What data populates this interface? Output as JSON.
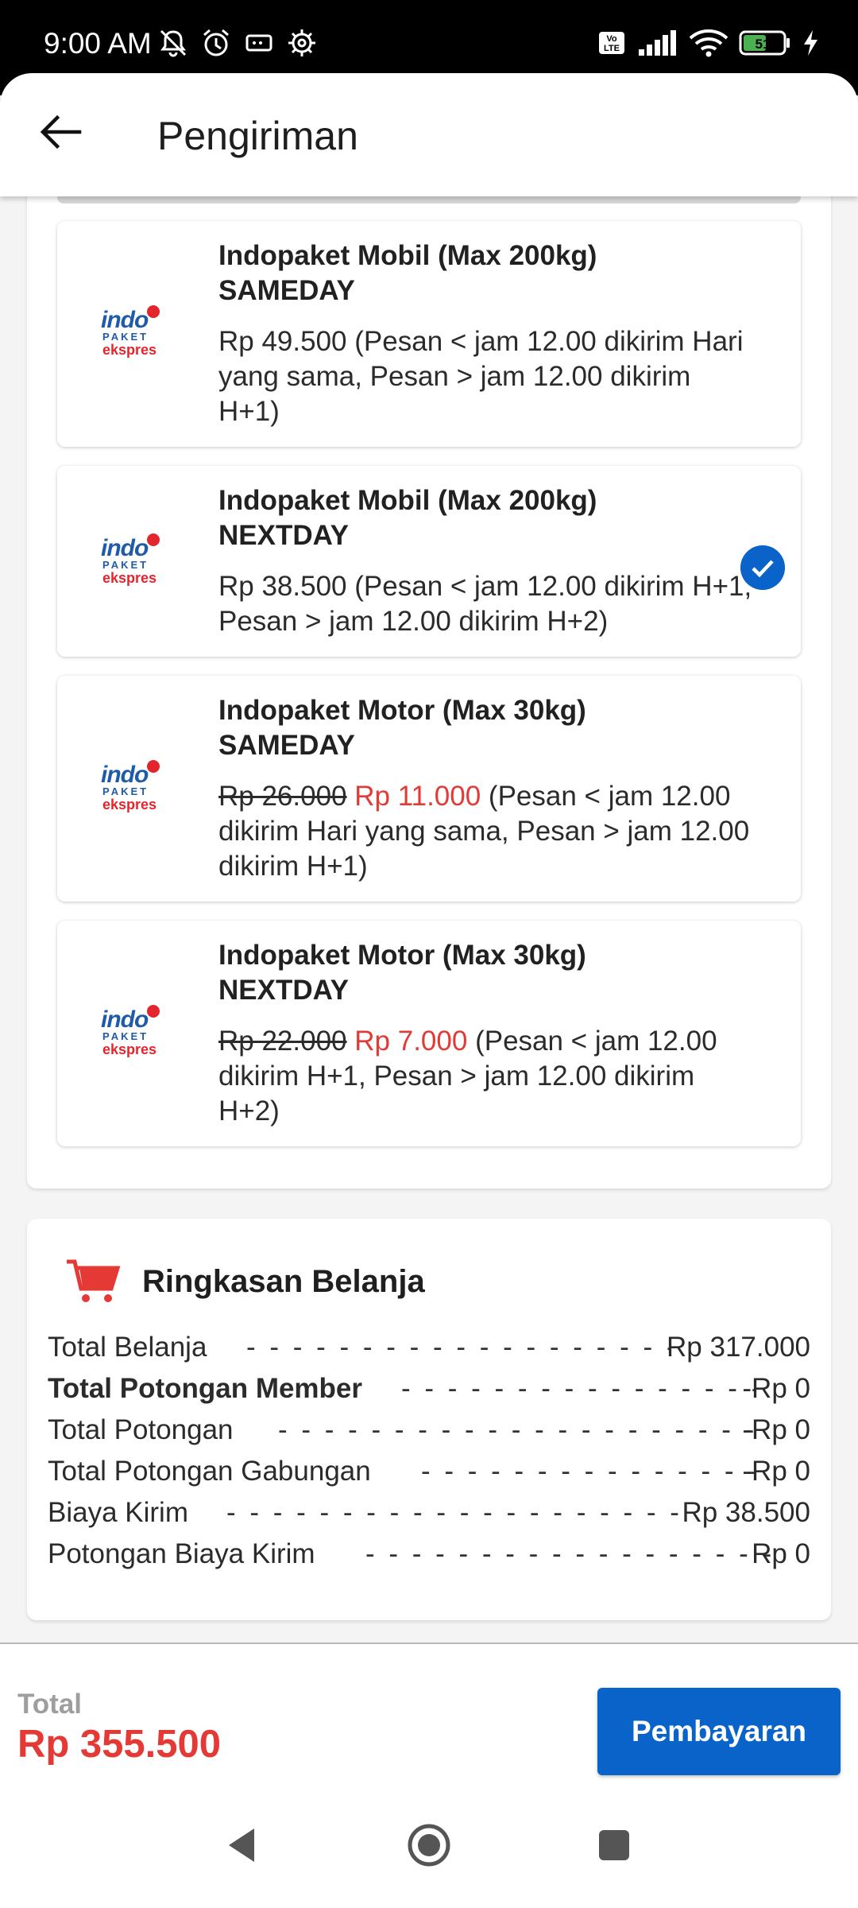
{
  "status_bar": {
    "time": "9:00 AM",
    "left_icons": [
      "mute-bell-icon",
      "alarm-icon",
      "cast-icon",
      "settings-icon"
    ],
    "right_icons": [
      "volte-icon",
      "signal-icon",
      "wifi-icon",
      "battery-icon",
      "charging-icon"
    ],
    "volte_text": "Vo LTE",
    "battery_level": "51"
  },
  "header": {
    "title": "Pengiriman",
    "back_icon": "arrow-left-icon"
  },
  "shipping_options": [
    {
      "title_line1": "Indopaket Mobil (Max 200kg)",
      "title_line2": "SAMEDAY",
      "original_price": "",
      "price": "Rp 49.500",
      "note": "(Pesan < jam 12.00 dikirim Hari yang sama, Pesan > jam 12.00 dikirim H+1)",
      "selected": false
    },
    {
      "title_line1": "Indopaket Mobil (Max 200kg)",
      "title_line2": "NEXTDAY",
      "original_price": "",
      "price": "Rp 38.500",
      "note": "(Pesan < jam 12.00 dikirim H+1, Pesan > jam 12.00 dikirim H+2)",
      "selected": true
    },
    {
      "title_line1": "Indopaket Motor (Max 30kg)",
      "title_line2": "SAMEDAY",
      "original_price": "Rp 26.000",
      "price": "Rp 11.000",
      "note": "(Pesan < jam 12.00 dikirim Hari yang sama, Pesan > jam 12.00 dikirim H+1)",
      "selected": false
    },
    {
      "title_line1": "Indopaket Motor (Max 30kg)",
      "title_line2": "NEXTDAY",
      "original_price": "Rp 22.000",
      "price": "Rp 7.000",
      "note": "(Pesan < jam 12.00 dikirim H+1, Pesan > jam 12.00 dikirim H+2)",
      "selected": false
    }
  ],
  "logo": {
    "indo": "indo",
    "paket": "PAKET",
    "ekspres": "ekspres"
  },
  "summary": {
    "title": "Ringkasan Belanja",
    "icon": "cart-icon",
    "rows": [
      {
        "label": "Total Belanja",
        "value": "Rp 317.000",
        "bold": false
      },
      {
        "label": "Total Potongan Member",
        "value": "-Rp 0",
        "bold": true
      },
      {
        "label": "Total Potongan",
        "value": "-Rp 0",
        "bold": false
      },
      {
        "label": "Total Potongan Gabungan",
        "value": "-Rp 0",
        "bold": false
      },
      {
        "label": "Biaya Kirim",
        "value": "Rp 38.500",
        "bold": false
      },
      {
        "label": "Potongan Biaya Kirim",
        "value": "Rp 0",
        "bold": false
      }
    ]
  },
  "footer": {
    "total_label": "Total",
    "total_value": "Rp 355.500",
    "pay_button": "Pembayaran"
  },
  "nav": {
    "back": "nav-back-icon",
    "home": "nav-home-icon",
    "recents": "nav-recents-icon"
  },
  "colors": {
    "accent_blue": "#0a63c9",
    "price_red": "#e53935",
    "logo_blue": "#1f5ba8",
    "logo_red": "#e3262e"
  }
}
